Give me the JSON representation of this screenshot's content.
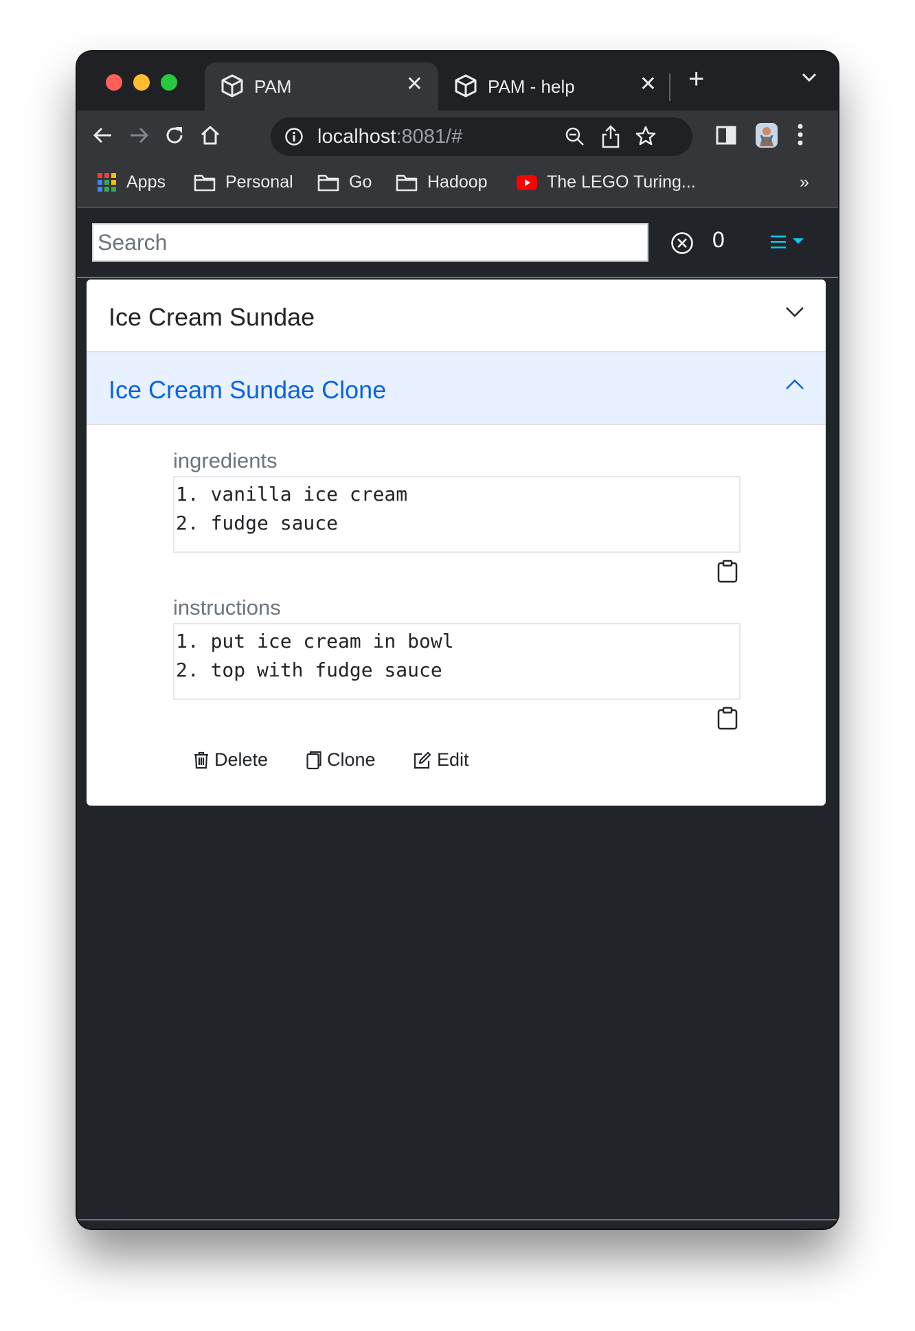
{
  "browser": {
    "tabs": [
      {
        "title": "PAM",
        "active": true
      },
      {
        "title": "PAM - help",
        "active": false
      }
    ],
    "url_host": "localhost",
    "url_rest": ":8081/#",
    "bookmarks": [
      {
        "label": "Apps",
        "icon": "apps-grid-icon"
      },
      {
        "label": "Personal",
        "icon": "folder-icon"
      },
      {
        "label": "Go",
        "icon": "folder-icon"
      },
      {
        "label": "Hadoop",
        "icon": "folder-icon"
      },
      {
        "label": "The LEGO Turing...",
        "icon": "youtube-icon"
      }
    ],
    "bookmarks_overflow": "»"
  },
  "app": {
    "search_placeholder": "Search",
    "result_count": "0",
    "accent_color": "#0dcaf0",
    "items": [
      {
        "title": "Ice Cream Sundae",
        "expanded": false
      },
      {
        "title": "Ice Cream Sundae Clone",
        "expanded": true
      }
    ],
    "detail": {
      "ingredients_label": "ingredients",
      "ingredients": [
        "1. vanilla ice cream",
        "2. fudge sauce"
      ],
      "instructions_label": "instructions",
      "instructions": [
        "1. put ice cream in bowl",
        "2. top with fudge sauce"
      ],
      "actions": {
        "delete": "Delete",
        "clone": "Clone",
        "edit": "Edit"
      }
    }
  }
}
